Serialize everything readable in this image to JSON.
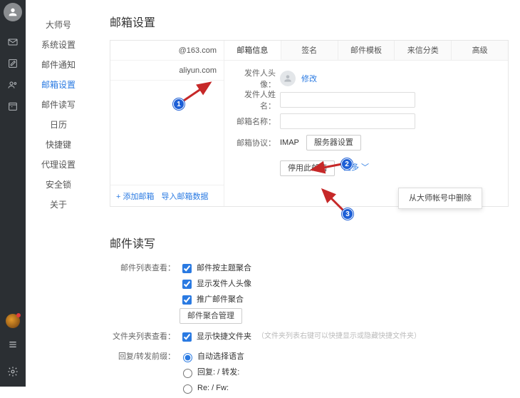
{
  "rail": {
    "icons": [
      "mail",
      "compose",
      "contacts",
      "calendar"
    ]
  },
  "nav": {
    "items": [
      {
        "label": "大师号"
      },
      {
        "label": "系统设置"
      },
      {
        "label": "邮件通知"
      },
      {
        "label": "邮箱设置",
        "active": true
      },
      {
        "label": "邮件读写"
      },
      {
        "label": "日历"
      },
      {
        "label": "快捷键"
      },
      {
        "label": "代理设置"
      },
      {
        "label": "安全锁"
      },
      {
        "label": "关于"
      }
    ]
  },
  "mailbox": {
    "title": "邮箱设置",
    "accounts": [
      {
        "label": "@163.com"
      },
      {
        "label": "aliyun.com",
        "selected": true
      }
    ],
    "footer": {
      "add": "+ 添加邮箱",
      "import": "导入邮箱数据"
    },
    "tabs": [
      "邮箱信息",
      "签名",
      "邮件模板",
      "来信分类",
      "高级"
    ],
    "active_tab": 0,
    "form": {
      "avatar_label": "发件人头像：",
      "avatar_action": "修改",
      "name_label": "发件人姓名：",
      "name_value": "",
      "boxname_label": "邮箱名称：",
      "boxname_value": "",
      "proto_label": "邮箱协议：",
      "proto_value": "IMAP",
      "server_btn": "服务器设置",
      "disable_btn": "停用此邮箱",
      "more_btn": "更多"
    },
    "dropdown_item": "从大师帐号中删除"
  },
  "readwrite": {
    "title": "邮件读写",
    "list_label": "邮件列表查看：",
    "checks": [
      {
        "label": "邮件按主题聚合",
        "checked": true
      },
      {
        "label": "显示发件人头像",
        "checked": true
      },
      {
        "label": "推广邮件聚合",
        "checked": true
      }
    ],
    "manage_btn": "邮件聚合管理",
    "folder_label": "文件夹列表查看：",
    "folder_check": {
      "label": "显示快捷文件夹",
      "checked": true
    },
    "folder_hint": "（文件夹列表右键可以快捷显示或隐藏快捷文件夹）",
    "reply_label": "回复/转发前缀：",
    "reply_opts": [
      {
        "label": "自动选择语言",
        "checked": true
      },
      {
        "label": "回复: / 转发:",
        "checked": false
      },
      {
        "label": "Re: / Fw:",
        "checked": false
      }
    ]
  },
  "badges": {
    "b1": "1",
    "b2": "2",
    "b3": "3"
  }
}
